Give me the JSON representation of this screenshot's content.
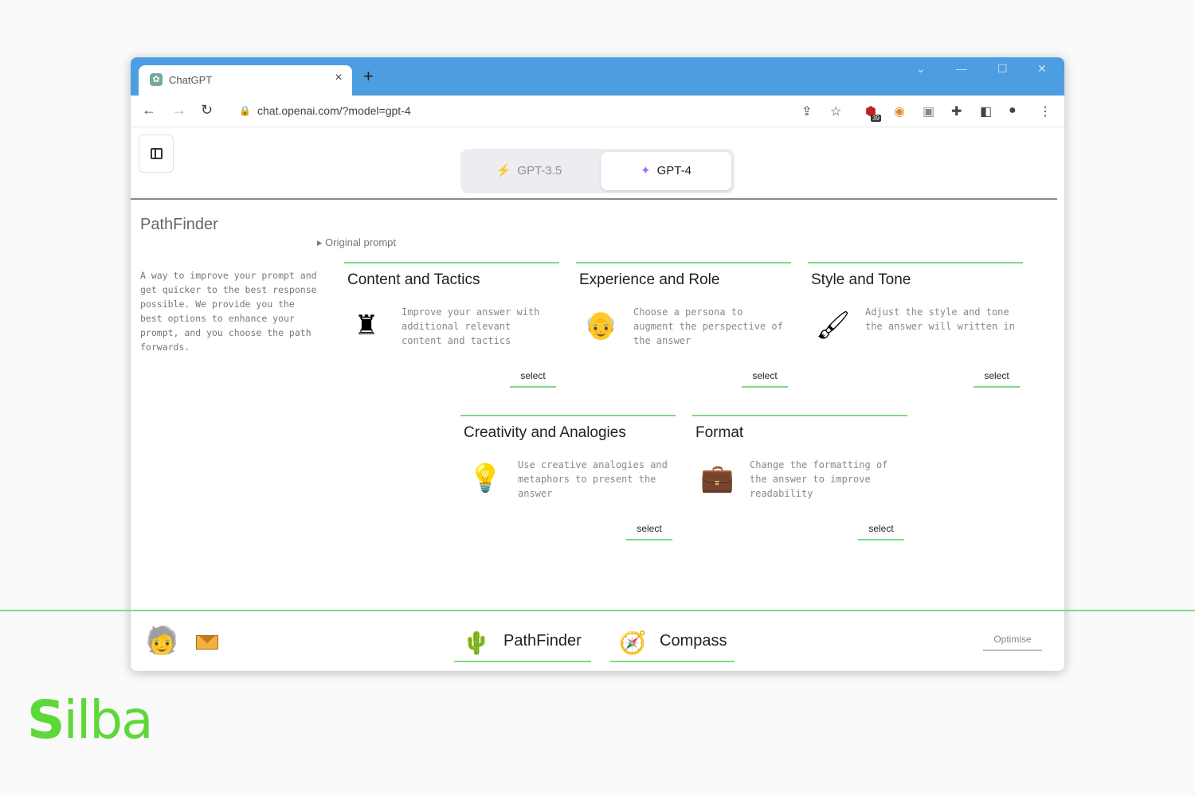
{
  "browser": {
    "tab_title": "ChatGPT",
    "tab_close": "×",
    "new_tab": "+",
    "url": "chat.openai.com/?model=gpt-4",
    "ext_badge": "39"
  },
  "app": {
    "model_switch": [
      {
        "label": "GPT-3.5",
        "icon": "lightning-icon",
        "active": false
      },
      {
        "label": "GPT-4",
        "icon": "sparkle-icon",
        "active": true
      }
    ]
  },
  "pathfinder": {
    "title": "PathFinder",
    "original_prompt": "Original prompt",
    "description": "A way to improve your prompt and get quicker to the best response possible. We provide you the best options to enhance your prompt, and you choose the path forwards.",
    "cards": [
      {
        "title": "Content and Tactics",
        "desc": "Improve your answer with additional relevant content and tactics",
        "icon": "chess-piece-icon",
        "select": "select"
      },
      {
        "title": "Experience and Role",
        "desc": "Choose a persona to augment the perspective of the answer",
        "icon": "persona-icon",
        "select": "select"
      },
      {
        "title": "Style and Tone",
        "desc": "Adjust the style and tone the answer will written in",
        "icon": "brushes-icon",
        "select": "select"
      },
      {
        "title": "Creativity and Analogies",
        "desc": "Use creative analogies and metaphors to present the answer",
        "icon": "lightbulb-icon",
        "select": "select"
      },
      {
        "title": "Format",
        "desc": "Change the formatting of the answer to improve readability",
        "icon": "briefcase-icon",
        "select": "select"
      }
    ]
  },
  "bottom": {
    "tabs": [
      {
        "label": "PathFinder",
        "icon": "signpost-icon"
      },
      {
        "label": "Compass",
        "icon": "compass-icon"
      }
    ],
    "optimise": "Optimise"
  },
  "brand": {
    "logo_first": "S",
    "logo_rest": "ilba",
    "accent": "#7ddc82",
    "tabstrip": "#4c9ee0"
  }
}
